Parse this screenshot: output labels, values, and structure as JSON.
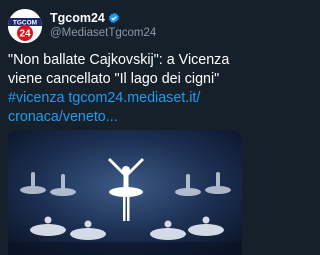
{
  "account": {
    "display_name": "Tgcom24",
    "handle": "@MediasetTgcom24",
    "avatar_logo": "tgcom24-logo",
    "avatar_text_top": "TGCOM",
    "avatar_text_bottom": "24"
  },
  "tweet": {
    "text_line_1": "\"Non ballate Cajkovskij\": a Vicenza",
    "text_line_2": "viene cancellato \"Il lago dei cigni\"",
    "hashtag": "#vicenza",
    "link_1": "tgcom24.mediaset.it/",
    "link_2": "cronaca/veneto..."
  },
  "media": {
    "description_icon": "ballet-photo"
  },
  "colors": {
    "background": "#15202b",
    "text": "#ffffff",
    "secondary_text": "#8899a6",
    "link": "#1d9bf0",
    "brand_red": "#d7141e"
  }
}
